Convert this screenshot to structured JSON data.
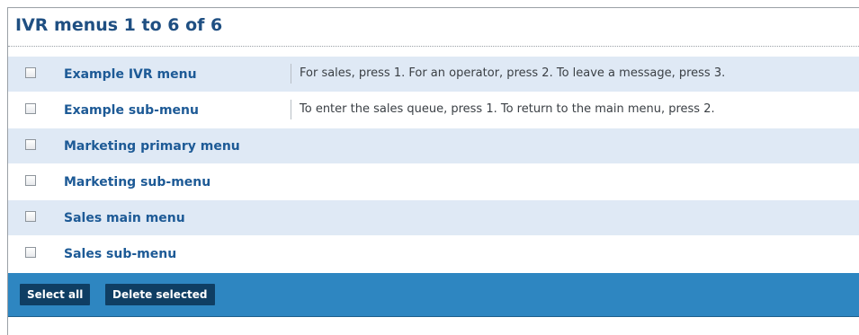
{
  "header": {
    "title": "IVR menus 1 to 6 of 6"
  },
  "rows": [
    {
      "name": "Example IVR menu",
      "description": "For sales, press 1. For an operator, press 2. To leave a message, press 3."
    },
    {
      "name": "Example sub-menu",
      "description": "To enter the sales queue, press 1. To return to the main menu, press 2."
    },
    {
      "name": "Marketing primary menu",
      "description": ""
    },
    {
      "name": "Marketing sub-menu",
      "description": ""
    },
    {
      "name": "Sales main menu",
      "description": ""
    },
    {
      "name": "Sales sub-menu",
      "description": ""
    }
  ],
  "footer": {
    "select_all_label": "Select all",
    "delete_selected_label": "Delete selected"
  },
  "colors": {
    "title": "#1f4f82",
    "link": "#1d5a96",
    "row_shaded": "#dfe9f5",
    "footer_bar": "#2e86c1",
    "button": "#0f3e63"
  }
}
